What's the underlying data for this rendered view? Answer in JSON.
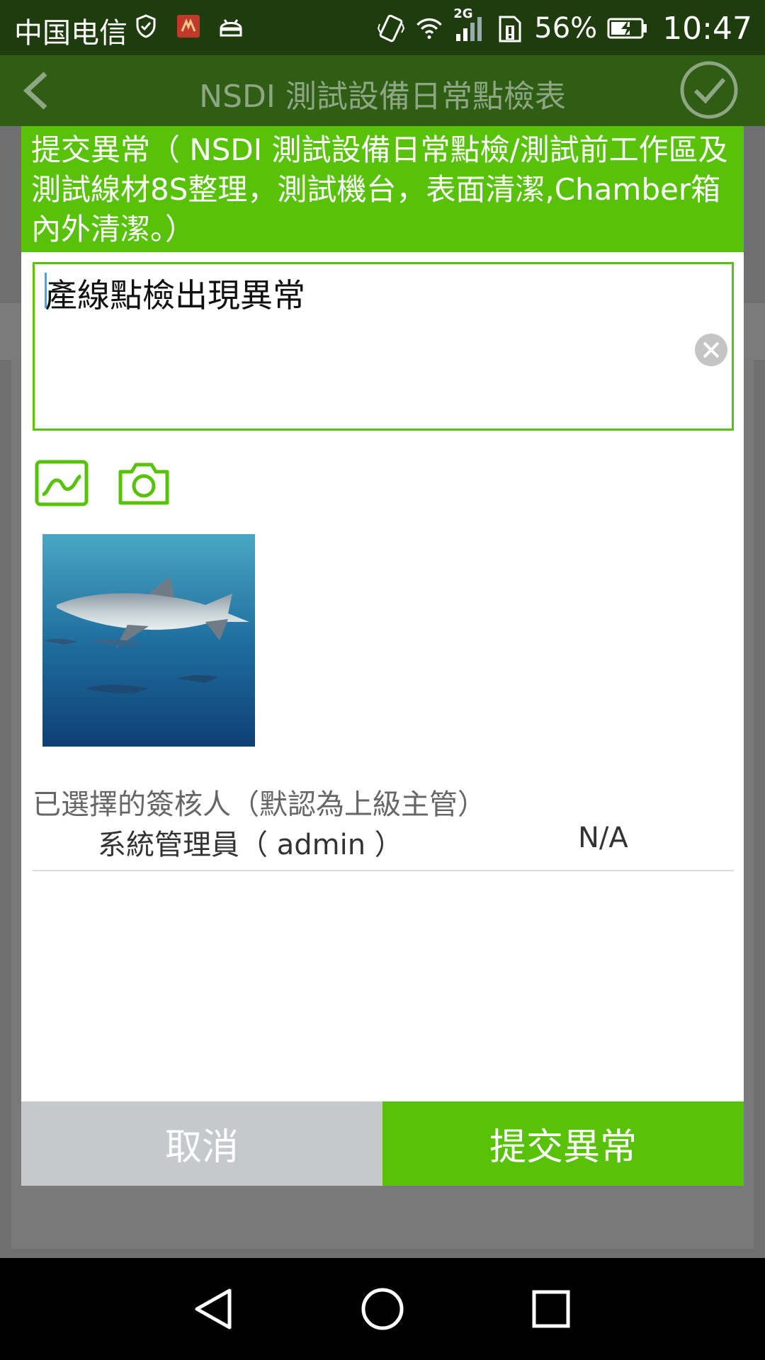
{
  "status_bar": {
    "carrier": "中国电信",
    "network": "2G",
    "battery": "56%",
    "time": "10:47"
  },
  "title_bar": {
    "title": "NSDI 測試設備日常點檢表"
  },
  "dialog": {
    "header": "提交異常（ NSDI 測試設備日常點檢/測試前工作區及測試線材8S整理，測試機台，表面清潔,Chamber箱內外清潔。）",
    "description_value": "產線點檢出現異常",
    "approver_label": "已選擇的簽核人（默認為上級主管）",
    "approvers": [
      {
        "name": "系統管理員（ admin ）",
        "status": "N/A"
      }
    ],
    "cancel_label": "取消",
    "submit_label": "提交異常"
  },
  "colors": {
    "accent_green": "#58c20a",
    "cancel_gray": "#c6c9cc",
    "status_bar": "#1f3c0e"
  }
}
